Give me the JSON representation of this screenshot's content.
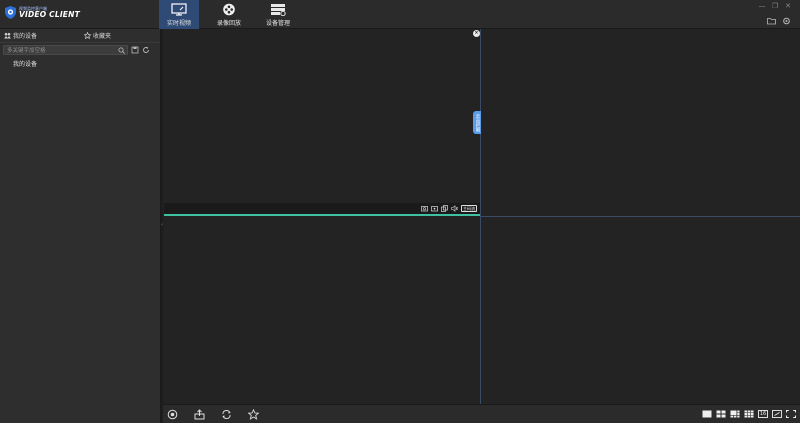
{
  "app": {
    "brand_small": "视频监控客户端",
    "brand_big": "VIDEO CLIENT"
  },
  "nav": {
    "tabs": [
      {
        "label": "实时视频",
        "icon": "monitor-icon",
        "active": true
      },
      {
        "label": "录像回放",
        "icon": "film-reel-icon",
        "active": false
      },
      {
        "label": "设备管理",
        "icon": "device-manage-icon",
        "active": false
      }
    ]
  },
  "window": {
    "minimize": "—",
    "restore": "❐",
    "close": "✕"
  },
  "sidebar": {
    "tabs": [
      {
        "label": "我的设备",
        "icon": "devices-icon"
      },
      {
        "label": "收藏夹",
        "icon": "star-icon"
      }
    ],
    "search": {
      "placeholder": "多关键字加空格",
      "value": ""
    },
    "tree": [
      {
        "label": "我的设备"
      }
    ]
  },
  "video": {
    "close_symbol": "×",
    "side_tab_label": "云台控制",
    "stream_tag": "主码流"
  },
  "layouts": {
    "sixteen_label": "16"
  },
  "colors": {
    "accent_blue": "#2f4a74",
    "selected_pane_line": "#3fc1a1",
    "side_tab_blue": "#5b9be8"
  }
}
